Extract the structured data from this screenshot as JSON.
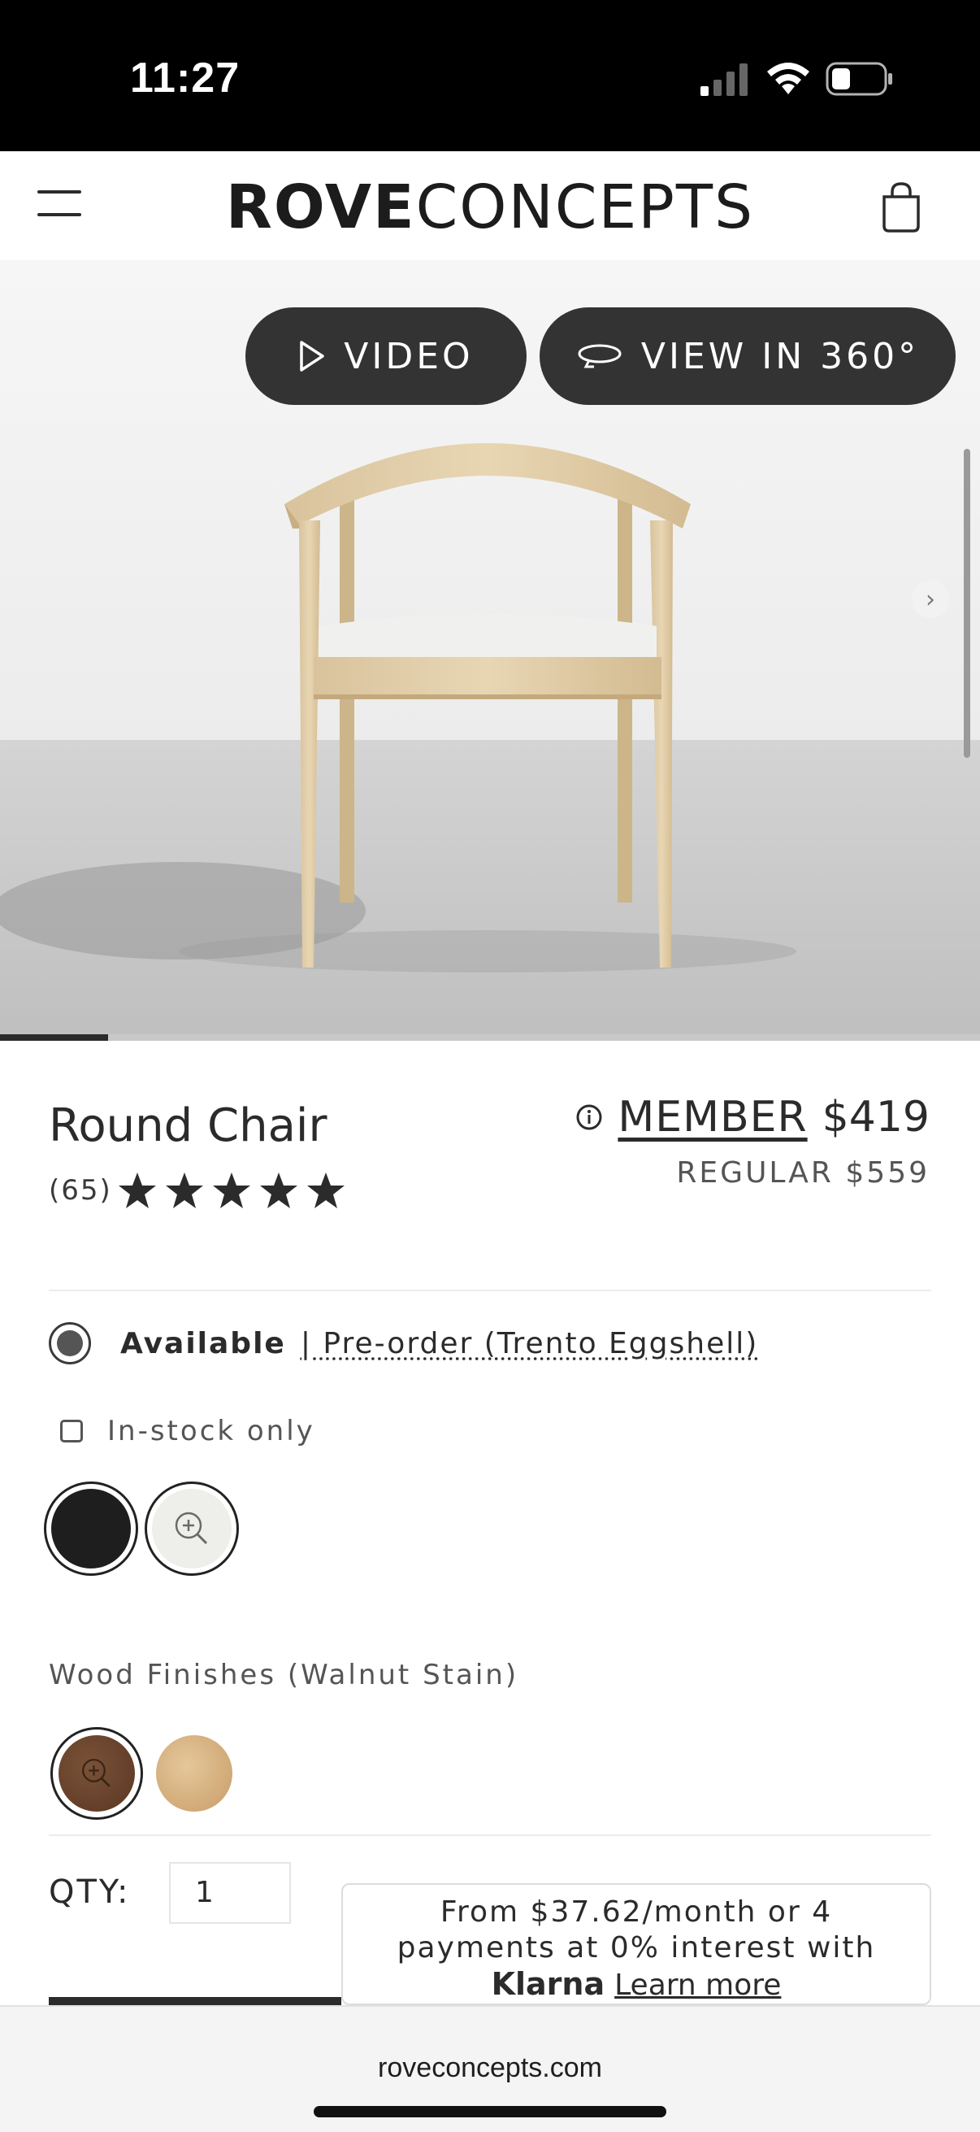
{
  "status_bar": {
    "time": "11:27"
  },
  "header": {
    "logo_bold": "ROVE",
    "logo_light": "CONCEPTS"
  },
  "hero": {
    "video_label": "VIDEO",
    "view360_label": "VIEW IN 360°",
    "image_progress": 0.11
  },
  "product": {
    "name": "Round Chair",
    "review_count": "(65)",
    "rating": 5,
    "member_label": "MEMBER",
    "member_price": "$419",
    "regular_price": "REGULAR $559"
  },
  "availability": {
    "label": "Available",
    "preorder": "| Pre-order (Trento Eggshell)",
    "instock_label": "In-stock only"
  },
  "fabric_swatches": [
    {
      "name": "black",
      "color": "#1e1e1e"
    },
    {
      "name": "zoom",
      "color": "#eeeeea"
    }
  ],
  "wood": {
    "label": "Wood Finishes (Walnut Stain)",
    "swatches": [
      {
        "name": "walnut",
        "color": "#6a4430"
      },
      {
        "name": "natural",
        "color": "#d8b583"
      }
    ]
  },
  "purchase": {
    "qty_label": "QTY:",
    "qty_value": "1"
  },
  "klarna": {
    "line1": "From $37.62/month or 4",
    "line2": "payments at 0% interest with",
    "brand": "Klarna",
    "learn_more": "Learn more"
  },
  "browser": {
    "url": "roveconcepts.com"
  }
}
